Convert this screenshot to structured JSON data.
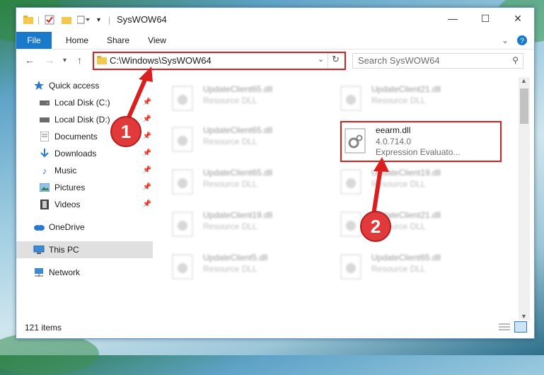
{
  "window": {
    "title": "SysWOW64"
  },
  "ribbon": {
    "tabs": [
      "File",
      "Home",
      "Share",
      "View"
    ]
  },
  "address": {
    "path": "C:\\Windows\\SysWOW64"
  },
  "search": {
    "placeholder": "Search SysWOW64"
  },
  "sidebar": {
    "items": [
      {
        "label": "Quick access",
        "icon": "star-icon"
      },
      {
        "label": "Local Disk (C:)",
        "icon": "drive-icon"
      },
      {
        "label": "Local Disk (D:)",
        "icon": "drive-icon"
      },
      {
        "label": "Documents",
        "icon": "documents-icon"
      },
      {
        "label": "Downloads",
        "icon": "download-icon"
      },
      {
        "label": "Music",
        "icon": "music-icon"
      },
      {
        "label": "Pictures",
        "icon": "pictures-icon"
      },
      {
        "label": "Videos",
        "icon": "videos-icon"
      },
      {
        "label": "OneDrive",
        "icon": "cloud-icon"
      },
      {
        "label": "This PC",
        "icon": "computer-icon"
      },
      {
        "label": "Network",
        "icon": "network-icon"
      }
    ]
  },
  "files": [
    {
      "name": "UpdateClient65.dll",
      "sub": "Resource DLL"
    },
    {
      "name": "UpdateClient21.dll",
      "sub": "Resource DLL"
    },
    {
      "name": "UpdateClient65.dll",
      "sub": "Resource DLL"
    },
    {
      "name": "eearm.dll",
      "sub": "4.0.714.0",
      "sub2": "Expression Evaluato..."
    },
    {
      "name": "UpdateClient65.dll",
      "sub": "Resource DLL"
    },
    {
      "name": "UpdateClient19.dll",
      "sub": "Resource DLL"
    },
    {
      "name": "UpdateClient19.dll",
      "sub": "Resource DLL"
    },
    {
      "name": "UpdateClient21.dll",
      "sub": "Resource DLL"
    },
    {
      "name": "UpdateClient5.dll",
      "sub": "Resource DLL"
    },
    {
      "name": "UpdateClient65.dll",
      "sub": "Resource DLL"
    }
  ],
  "status": {
    "items": "121 items"
  },
  "callouts": {
    "one": "1",
    "two": "2"
  },
  "colors": {
    "accent": "#1979ca",
    "highlight": "#d9201f"
  }
}
